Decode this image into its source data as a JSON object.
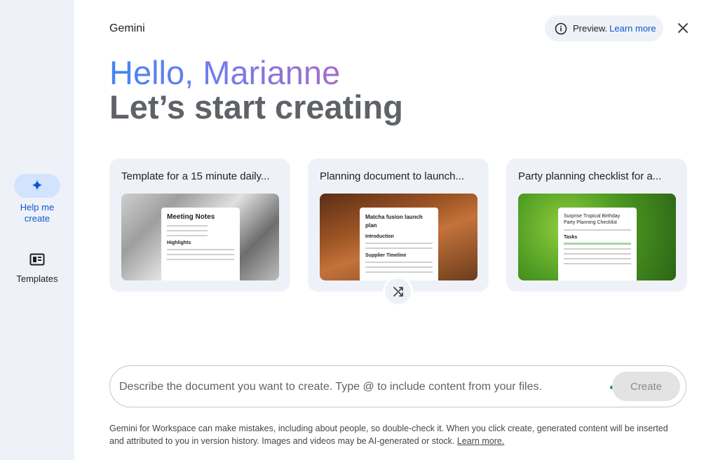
{
  "sidebar": {
    "items": [
      {
        "label": "Help me create",
        "icon": "sparkle-icon",
        "active": true
      },
      {
        "label": "Templates",
        "icon": "templates-icon",
        "active": false
      }
    ]
  },
  "header": {
    "app_name": "Gemini",
    "preview_label": "Preview.",
    "learn_more": "Learn more"
  },
  "greeting": {
    "hello": "Hello, Marianne",
    "subtitle": "Let’s start creating"
  },
  "cards": [
    {
      "title": "Template for a 15 minute daily...",
      "doc_title": "Meeting Notes",
      "doc_section": "Highlights"
    },
    {
      "title": "Planning document to launch...",
      "doc_title": "Matcha fusion launch plan",
      "doc_section": "Introduction",
      "doc_section2": "Supplier Timeline"
    },
    {
      "title": "Party planning checklist for a...",
      "doc_title": "Surprise Tropical Birthday Party Planning Checklist",
      "doc_section": "Tasks"
    }
  ],
  "prompt": {
    "placeholder": "Describe the document you want to create. Type @ to include content from your files.",
    "value": "",
    "create_label": "Create"
  },
  "disclaimer": {
    "text": "Gemini for Workspace can make mistakes, including about people, so double-check it. When you click create, generated content will be inserted and attributed to you in version history. Images and videos may be AI-generated or stock.",
    "link": "Learn more."
  },
  "colors": {
    "accent": "#0b57d0",
    "rail_bg": "#eef2f8",
    "active_pill": "#d3e3fd",
    "greeting_gradient": [
      "#4285f4",
      "#a66ec9"
    ]
  }
}
